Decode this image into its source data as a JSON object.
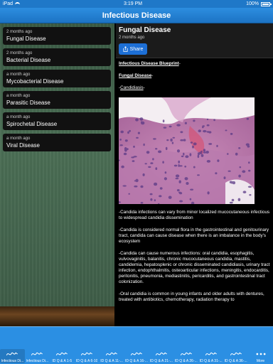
{
  "status_bar": {
    "device": "iPad",
    "time": "3:19 PM",
    "battery": "100%",
    "battery_level": 1.0
  },
  "nav": {
    "title": "Infectious Disease"
  },
  "list": [
    {
      "time": "2 months ago",
      "title": "Fungal Disease"
    },
    {
      "time": "2 months ago",
      "title": "Bacterial Disease"
    },
    {
      "time": "a month ago",
      "title": "Mycobacterial Disease"
    },
    {
      "time": "a month ago",
      "title": "Parasitic Disease"
    },
    {
      "time": "a month ago",
      "title": "Spirochetal Disease"
    },
    {
      "time": "a month ago",
      "title": "Viral Disease"
    }
  ],
  "detail": {
    "title": "Fungal Disease",
    "time": "2 months ago",
    "share_label": "Share",
    "line1": "Infectious Disease Blueprint",
    "line1_suffix": "-",
    "line2": "Fungal Disease",
    "line2_suffix": "-",
    "line3_prefix": "-",
    "line3": "Candidiasis",
    "line3_suffix": "-",
    "p1": "-Candida infections can vary from minor localized mucocutaneous infectious to widespread candidia dissemination",
    "p2": "-Candida is considered normal flora in the gastrointestinal and genitourinary tract, candida can cause disease when there is an imbalance in the body's ecosystem",
    "p3": "-Candida can cause numerous infections: oral candidia, esophagitis, vulvovaginitis, balanitis, chronic mucocutaneous candidia, mastitis, candidemia, hepatosplenic or chronic disseminated candidiasis, urinary tract infection, endophthalmitis, osteoarticular infections, meningitis, endocarditis, peritonitis, pneumonia, mediastinitis, pericarditis, and gastrointestinal tract colonization.",
    "p4": "-Oral candidia is common in young infants and older adults with dentures, treated with antibiotics, chemotherapy, radiation therapy to"
  },
  "tabs": [
    {
      "label": "Infectious Di...",
      "icon": "ecg-wave-icon",
      "active": true
    },
    {
      "label": "Infectious Di...",
      "icon": "ecg-wave-icon"
    },
    {
      "label": "ID Q & A 1-5",
      "icon": "ecg-wave-icon"
    },
    {
      "label": "ID Q & A 6-10",
      "icon": "ecg-wave-icon"
    },
    {
      "label": "ID Q & A 11-...",
      "icon": "ecg-wave-icon"
    },
    {
      "label": "ID Q & A 16-...",
      "icon": "ecg-wave-icon"
    },
    {
      "label": "ID Q & A 21-...",
      "icon": "ecg-wave-icon"
    },
    {
      "label": "ID Q & A 26-...",
      "icon": "ecg-wave-icon"
    },
    {
      "label": "ID Q & A 31-...",
      "icon": "ecg-wave-icon"
    },
    {
      "label": "ID Q & A 36-...",
      "icon": "ecg-wave-icon"
    },
    {
      "label": "More",
      "icon": "more-dots-icon"
    }
  ],
  "colors": {
    "accent": "#2b8fe3",
    "share": "#1d6fd6",
    "chalkboard": "#4b6e55"
  }
}
